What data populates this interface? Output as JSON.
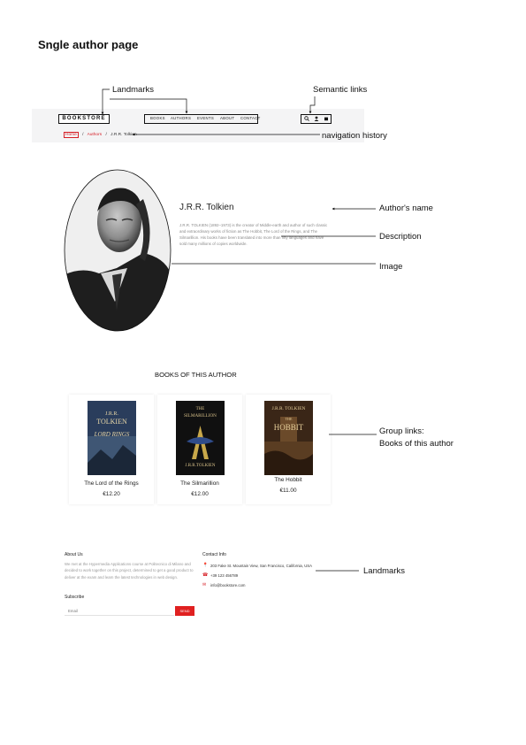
{
  "page_title": "Sngle author page",
  "annotations": {
    "landmarks_top": "Landmarks",
    "semantic_links": "Semantic links",
    "navigation_history": "navigation history",
    "authors_name": "Author's name",
    "description": "Description",
    "image": "Image",
    "group_links_line1": "Group links:",
    "group_links_line2": "Books of this author",
    "landmarks_bottom": "Landmarks"
  },
  "header": {
    "logo": "BOOKSTORE",
    "nav": [
      "BOOKS",
      "AUTHORS",
      "EVENTS",
      "ABOUT",
      "CONTACT"
    ],
    "icons": [
      "search-icon",
      "user-icon",
      "cart-icon"
    ],
    "breadcrumb": {
      "home": "Home",
      "sep": "/",
      "authors": "Authors",
      "current": "J.R.R. Tolkien"
    }
  },
  "author": {
    "name": "J.R.R. Tolkien",
    "description": "J.R.R. TOLKIEN (1892–1973) is the creator of Middle-earth and author of such classic and extraordinary works of fiction as The Hobbit, The Lord of the Rings, and The Silmarillion. His books have been translated into more than fifty languages and have sold many millions of copies worldwide."
  },
  "books": {
    "heading": "BOOKS OF THIS AUTHOR",
    "items": [
      {
        "title": "The Lord of the Rings",
        "price": "€12.20",
        "cover": {
          "top": "J.R.R.",
          "middle": "TOLKIEN",
          "bottom": "LORD\nRINGS",
          "bg": "#2a3d5c",
          "fg": "#e8d7a8"
        }
      },
      {
        "title": "The Silmarillion",
        "price": "€12.00",
        "cover": {
          "top": "THE",
          "middle": "SILMARILLION",
          "bottom": "J.R.R.TOLKIEN",
          "bg": "#101010",
          "fg": "#d9c28a"
        }
      },
      {
        "title": "The Hobbit",
        "price": "€11.00",
        "cover": {
          "top": "J.R.R. TOLKIEN",
          "middle": "THE",
          "bottom": "HOBBIT",
          "bg": "#3a2617",
          "fg": "#e6cf9a"
        }
      }
    ]
  },
  "footer": {
    "about_heading": "About Us",
    "about_text": "We met at the Hypermedia Applications course at Politecnico di Milano and decided to work together on this project, determined to get a good product to deliver at the exam and learn the latest technologies in web design.",
    "subscribe_heading": "Subscribe",
    "email_placeholder": "Email",
    "send_label": "SEND",
    "contact_heading": "Contact Info",
    "contact": [
      {
        "icon": "map-pin-icon",
        "text": "203 Fake St. Mountain View, San Francisco, California, USA"
      },
      {
        "icon": "phone-icon",
        "text": "+39 123 456789"
      },
      {
        "icon": "mail-icon",
        "text": "info@bookstore.com"
      }
    ]
  },
  "colors": {
    "accent": "#d61f26",
    "header_bg": "#f4f4f5",
    "send_button": "#e02020"
  }
}
